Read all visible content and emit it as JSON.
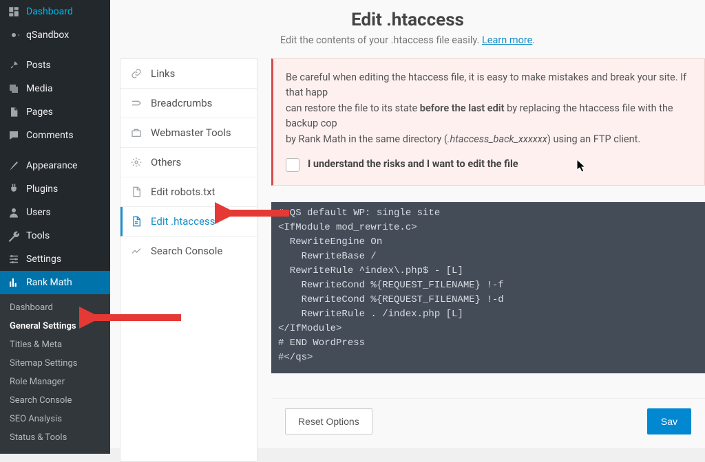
{
  "wp_menu": [
    {
      "icon": "dashboard",
      "label": "Dashboard"
    },
    {
      "icon": "gear",
      "label": "qSandbox"
    },
    {
      "sep": true
    },
    {
      "icon": "pin",
      "label": "Posts"
    },
    {
      "icon": "media",
      "label": "Media"
    },
    {
      "icon": "page",
      "label": "Pages"
    },
    {
      "icon": "comment",
      "label": "Comments"
    },
    {
      "sep": true
    },
    {
      "icon": "brush",
      "label": "Appearance"
    },
    {
      "icon": "plug",
      "label": "Plugins"
    },
    {
      "icon": "user",
      "label": "Users"
    },
    {
      "icon": "wrench",
      "label": "Tools"
    },
    {
      "icon": "sliders",
      "label": "Settings"
    },
    {
      "icon": "chart",
      "label": "Rank Math",
      "active": true
    }
  ],
  "rank_math_submenu": [
    {
      "label": "Dashboard"
    },
    {
      "label": "General Settings",
      "bold": true
    },
    {
      "label": "Titles & Meta"
    },
    {
      "label": "Sitemap Settings"
    },
    {
      "label": "Role Manager"
    },
    {
      "label": "Search Console"
    },
    {
      "label": "SEO Analysis"
    },
    {
      "label": "Status & Tools"
    }
  ],
  "header": {
    "title": "Edit .htaccess",
    "sub_pre": "Edit the contents of your .htaccess file easily. ",
    "learn_more": "Learn more"
  },
  "tabs": [
    {
      "icon": "link",
      "label": "Links"
    },
    {
      "icon": "crumb",
      "label": "Breadcrumbs"
    },
    {
      "icon": "case",
      "label": "Webmaster Tools"
    },
    {
      "icon": "gear2",
      "label": "Others"
    },
    {
      "icon": "file",
      "label": "Edit robots.txt"
    },
    {
      "icon": "file2",
      "label": "Edit .htaccess",
      "active": true
    },
    {
      "icon": "graph",
      "label": "Search Console"
    }
  ],
  "alert": {
    "l1a": "Be careful when editing the htaccess file, it is easy to make mistakes and break your site. If that happ",
    "l1b": "can restore the file to its state ",
    "l1bold": "before the last edit",
    "l1c": " by replacing the htaccess file with the backup cop",
    "l2a": "by Rank Math in the same directory (",
    "l2i": ".htaccess_back_xxxxxx",
    "l2b": ") using an FTP client.",
    "check_label": "I understand the risks and I want to edit the file"
  },
  "code_lines": [
    "# QS default WP: single site",
    "<IfModule mod_rewrite.c>",
    "  RewriteEngine On",
    "    RewriteBase /",
    "  RewriteRule ^index\\.php$ - [L]",
    "    RewriteCond %{REQUEST_FILENAME} !-f",
    "    RewriteCond %{REQUEST_FILENAME} !-d",
    "    RewriteRule . /index.php [L]",
    "</IfModule>",
    "# END WordPress",
    "#</qs>"
  ],
  "buttons": {
    "reset": "Reset Options",
    "save": "Sav"
  }
}
